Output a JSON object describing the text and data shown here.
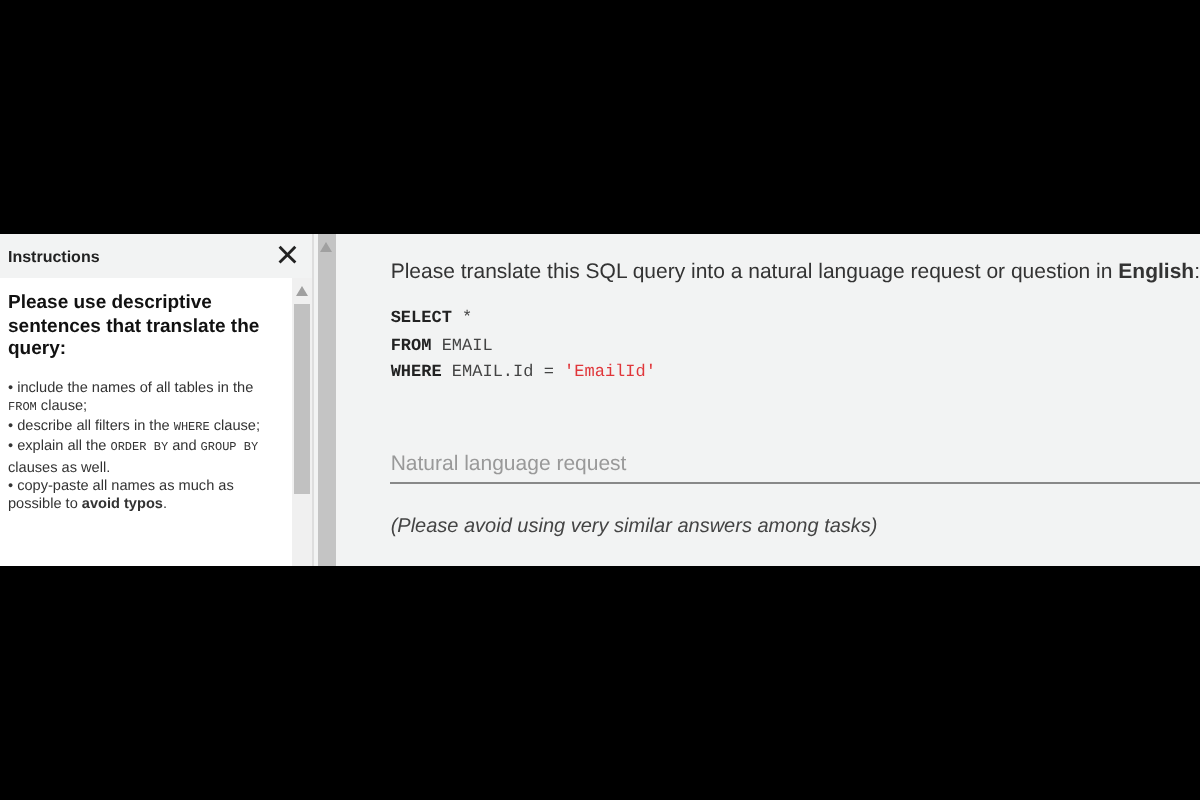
{
  "instructions": {
    "title": "Instructions",
    "close": "×",
    "heading": "Please use descriptive sentences that translate the query:",
    "bullets": [
      [
        {
          "kind": "plain",
          "text": "• include the names of all tables in the "
        },
        {
          "kind": "code",
          "text": "FROM"
        },
        {
          "kind": "plain",
          "text": " clause;"
        }
      ],
      [
        {
          "kind": "plain",
          "text": "• describe all filters in the "
        },
        {
          "kind": "code",
          "text": "WHERE"
        },
        {
          "kind": "plain",
          "text": " clause;"
        }
      ],
      [
        {
          "kind": "plain",
          "text": "• explain all the "
        },
        {
          "kind": "code",
          "text": "ORDER BY"
        },
        {
          "kind": "plain",
          "text": " and "
        },
        {
          "kind": "code",
          "text": "GROUP BY"
        },
        {
          "kind": "plain",
          "text": " clauses as well."
        }
      ],
      [
        {
          "kind": "plain",
          "text": "• copy-paste all names as much as possible to "
        },
        {
          "kind": "bold",
          "text": "avoid typos"
        },
        {
          "kind": "plain",
          "text": "."
        }
      ]
    ]
  },
  "task": {
    "prompt": "Please translate this SQL query into a natural language request or question in **English**:",
    "sql": [
      [
        {
          "kind": "keyword",
          "text": "SELECT"
        },
        {
          "kind": "plain",
          "text": " *"
        }
      ],
      [
        {
          "kind": "keyword",
          "text": "FROM"
        },
        {
          "kind": "plain",
          "text": " EMAIL"
        }
      ],
      [
        {
          "kind": "keyword",
          "text": "WHERE"
        },
        {
          "kind": "plain",
          "text": " EMAIL.Id = "
        },
        {
          "kind": "string",
          "text": "'EmailId'"
        }
      ]
    ],
    "field": {
      "placeholder": "Natural language request"
    },
    "note": "(Please avoid using very similar answers among tasks)"
  }
}
